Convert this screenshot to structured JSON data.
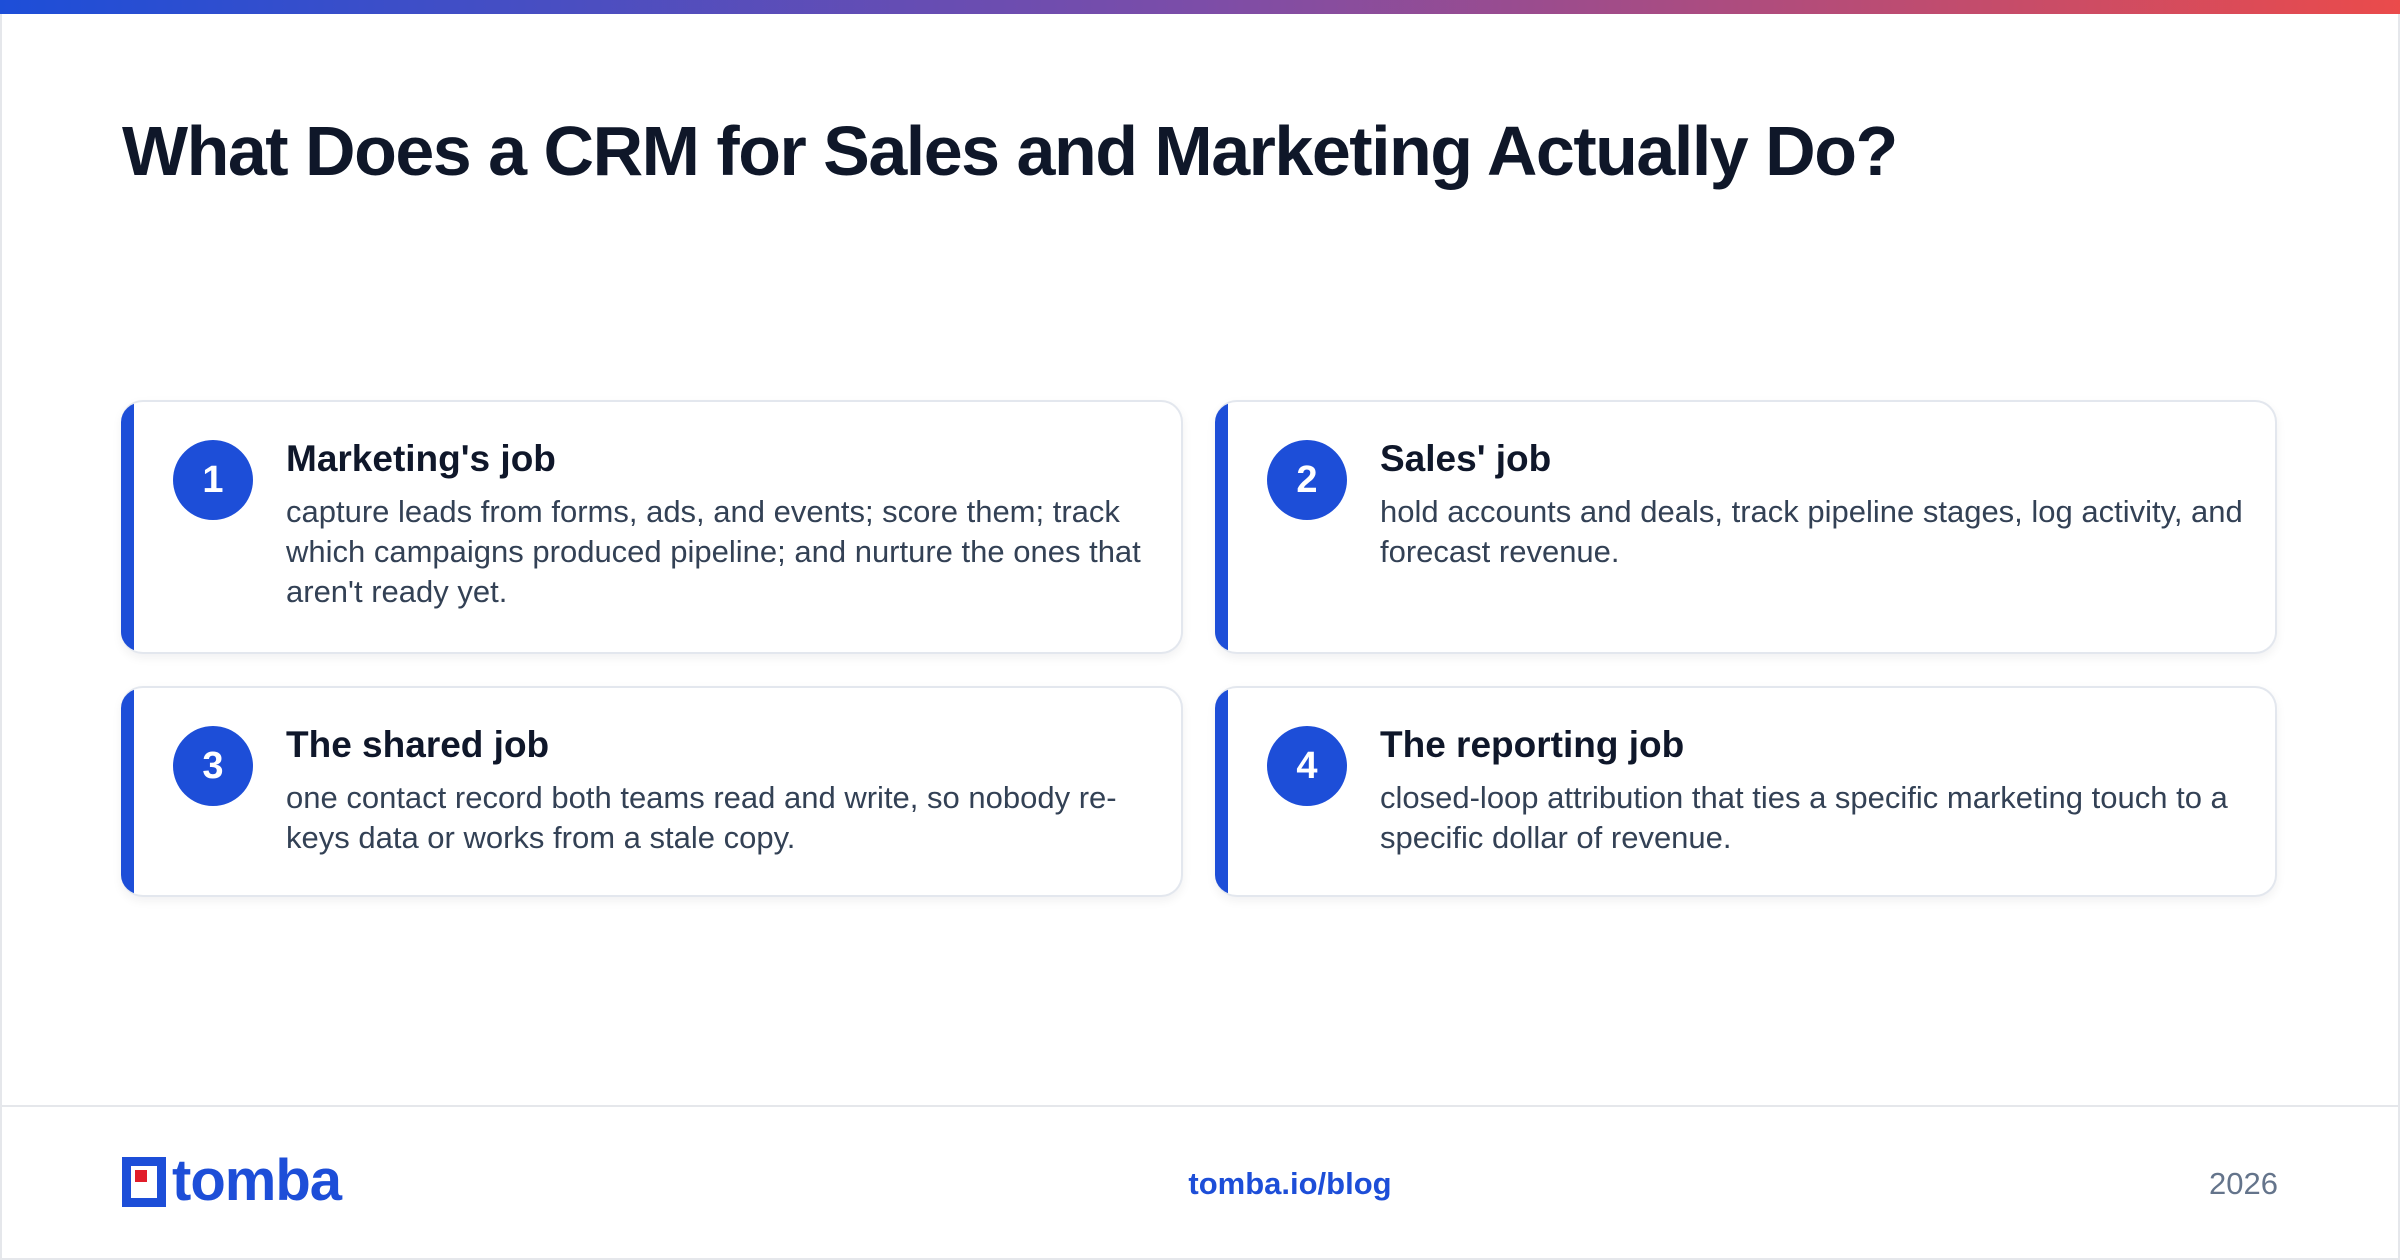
{
  "title": "What Does a CRM for Sales and Marketing Actually Do?",
  "cards": [
    {
      "number": "1",
      "title": "Marketing's job",
      "body": "capture leads from forms, ads, and events; score them; track which campaigns produced pipeline; and nurture the ones that aren't ready yet."
    },
    {
      "number": "2",
      "title": "Sales' job",
      "body": "hold accounts and deals, track pipeline stages, log activity, and forecast revenue."
    },
    {
      "number": "3",
      "title": "The shared job",
      "body": "one contact record both teams read and write, so nobody re-keys data or works from a stale copy."
    },
    {
      "number": "4",
      "title": "The reporting job",
      "body": "closed-loop attribution that ties a specific marketing touch to a specific dollar of revenue."
    }
  ],
  "footer": {
    "logo_text": "tomba",
    "link": "tomba.io/blog",
    "year": "2026"
  },
  "colors": {
    "accent": "#1d4ed8",
    "logo_red": "#e11d2a",
    "heading": "#0f172a",
    "body_text": "#334155",
    "muted": "#64748b"
  }
}
